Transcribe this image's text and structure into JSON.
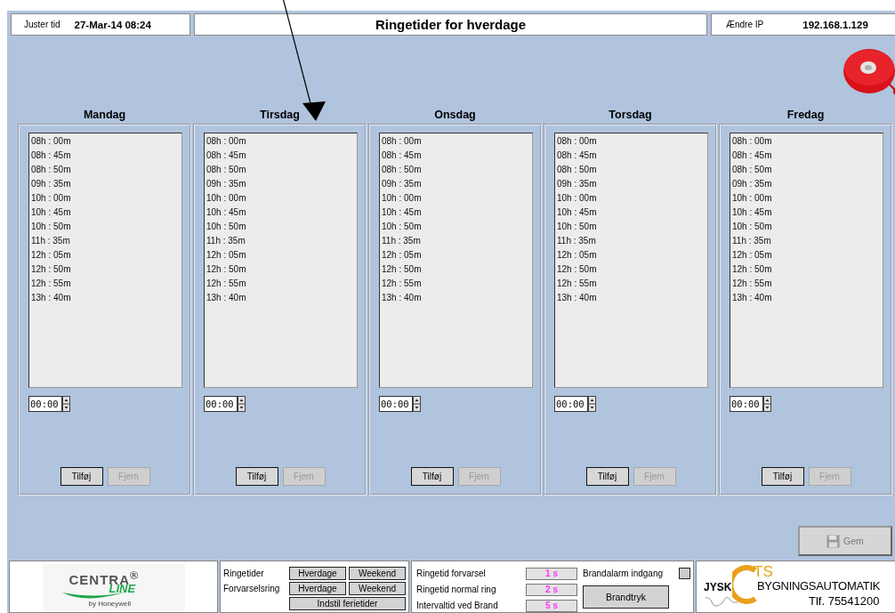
{
  "header": {
    "clock_label": "Juster tid",
    "clock_value": "27-Mar-14 08:24",
    "title": "Ringetider for hverdage",
    "ip_label": "Ændre IP",
    "ip_value": "192.168.1.129"
  },
  "days": [
    {
      "name": "Mandag",
      "times": [
        "08h : 00m",
        "08h : 45m",
        "08h : 50m",
        "09h : 35m",
        "10h : 00m",
        "10h : 45m",
        "10h : 50m",
        "11h : 35m",
        "12h : 05m",
        "12h : 50m",
        "12h : 55m",
        "13h : 40m"
      ],
      "time_input": "00:00",
      "buttons": [
        {
          "label": "Tilføj",
          "disabled": false
        },
        {
          "label": "Fjern",
          "disabled": true
        }
      ]
    },
    {
      "name": "Tirsdag",
      "times": [
        "08h : 00m",
        "08h : 45m",
        "08h : 50m",
        "09h : 35m",
        "10h : 00m",
        "10h : 45m",
        "10h : 50m",
        "11h : 35m",
        "12h : 05m",
        "12h : 50m",
        "12h : 55m",
        "13h : 40m"
      ],
      "time_input": "00:00",
      "buttons": [
        {
          "label": "Tilføj",
          "disabled": false
        },
        {
          "label": "Fjern",
          "disabled": true
        }
      ]
    },
    {
      "name": "Onsdag",
      "times": [
        "08h : 00m",
        "08h : 45m",
        "08h : 50m",
        "09h : 35m",
        "10h : 00m",
        "10h : 45m",
        "10h : 50m",
        "11h : 35m",
        "12h : 05m",
        "12h : 50m",
        "12h : 55m",
        "13h : 40m"
      ],
      "time_input": "00:00",
      "buttons": [
        {
          "label": "Tilføj",
          "disabled": false
        },
        {
          "label": "Fjern",
          "disabled": true
        }
      ]
    },
    {
      "name": "Torsdag",
      "times": [
        "08h : 00m",
        "08h : 45m",
        "08h : 50m",
        "09h : 35m",
        "10h : 00m",
        "10h : 45m",
        "10h : 50m",
        "11h : 35m",
        "12h : 05m",
        "12h : 50m",
        "12h : 55m",
        "13h : 40m"
      ],
      "time_input": "00:00",
      "buttons": [
        {
          "label": "Tilføj",
          "disabled": false
        },
        {
          "label": "Fjern",
          "disabled": true
        }
      ]
    },
    {
      "name": "Fredag",
      "times": [
        "08h : 00m",
        "08h : 45m",
        "08h : 50m",
        "09h : 35m",
        "10h : 00m",
        "10h : 45m",
        "10h : 50m",
        "11h : 35m",
        "12h : 05m",
        "12h : 50m",
        "12h : 55m",
        "13h : 40m"
      ],
      "time_input": "00:00",
      "buttons": [
        {
          "label": "Tilføj",
          "disabled": false
        },
        {
          "label": "Fjern",
          "disabled": true
        }
      ]
    }
  ],
  "save_button": {
    "label": "Gem",
    "disabled": true
  },
  "footer": {
    "centraline_logo": {
      "brand": "CENTRA$^{®}$",
      "line": "LINE",
      "tagline": "by Honeywell"
    },
    "schedule_rows": [
      {
        "label": "Ringetider",
        "buttons": [
          "Hverdage",
          "Weekend"
        ]
      },
      {
        "label": "Forvarselsring",
        "buttons": [
          "Hverdage",
          "Weekend"
        ]
      }
    ],
    "holiday_button": "Indstil ferietider",
    "settings": [
      {
        "label": "Ringetid forvarsel",
        "value": "1 s"
      },
      {
        "label": "Ringetid normal ring",
        "value": "2 s"
      },
      {
        "label": "Intervaltid ved Brand",
        "value": "5 s"
      }
    ],
    "fire_alarm_input": {
      "label": "Brandalarm indgang",
      "checked": false
    },
    "fire_button": "Brandtryk",
    "cts_logo": {
      "left": "JYSK",
      "top": "TS",
      "bottom": "BYGNINGSAUTOMATIK",
      "phone": "Tlf. 75541200"
    }
  }
}
